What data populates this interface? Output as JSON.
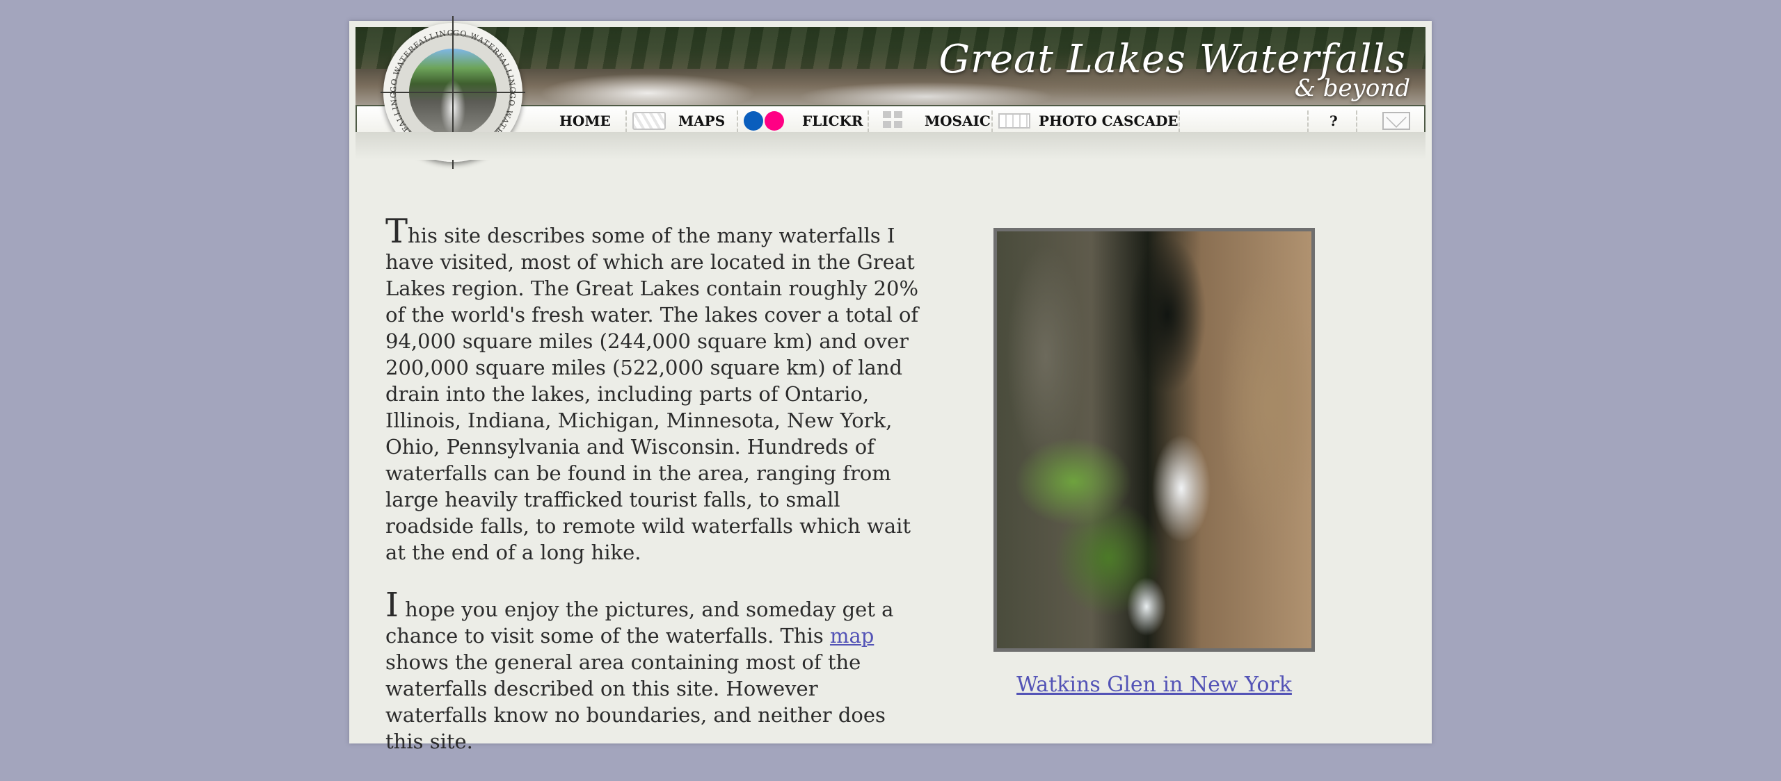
{
  "header": {
    "title": "Great Lakes Waterfalls",
    "subtitle": "& beyond",
    "logo_text": "GO WATERFALLING"
  },
  "nav": {
    "items": [
      {
        "label": "HOME",
        "icon": "none"
      },
      {
        "label": "MAPS",
        "icon": "map-icon"
      },
      {
        "label": "FLICKR",
        "icon": "flickr-icon"
      },
      {
        "label": "MOSAIC",
        "icon": "mosaic-icon"
      },
      {
        "label": "PHOTO CASCADE",
        "icon": "cascade-icon"
      },
      {
        "label": "?",
        "icon": "none"
      },
      {
        "label": "",
        "icon": "mail-icon"
      }
    ],
    "colors": {
      "flickr_blue": "#0a5ebd",
      "flickr_pink": "#ff0084"
    }
  },
  "intro": {
    "p1_dropcap": "T",
    "p1_text": "his site describes some of the many waterfalls I have visited, most of which are located in the Great Lakes region. The Great Lakes contain roughly 20% of the world's fresh water. The lakes cover a total of 94,000 square miles (244,000 square km) and over 200,000 square miles (522,000 square km) of land drain into the lakes, including parts of Ontario, Illinois, Indiana, Michigan, Minnesota, New York, Ohio, Pennsylvania and Wisconsin. Hundreds of waterfalls can be found in the area, ranging from large heavily trafficked tourist falls, to small roadside falls, to remote wild waterfalls which wait at the end of a long hike.",
    "p2_dropcap": "I",
    "p2_before_link": " hope you enjoy the pictures, and someday get a chance to visit some of the waterfalls. This ",
    "p2_link": "map",
    "p2_after_link": " shows the general area containing most of the waterfalls described on this site. However waterfalls know no boundaries, and neither does this site."
  },
  "feature": {
    "caption": "Watkins Glen in New York"
  },
  "colors": {
    "page_bg": "#a3a5bd",
    "content_bg": "#ecede7",
    "link": "#5353b6"
  }
}
